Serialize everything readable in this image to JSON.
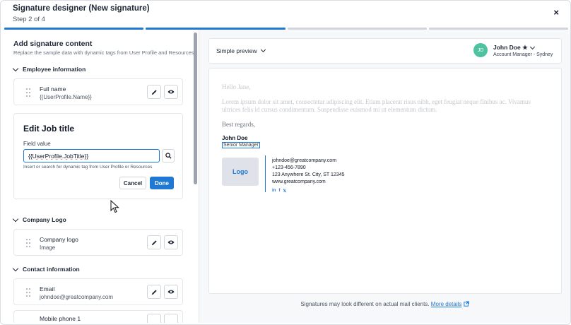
{
  "header": {
    "title": "Signature designer (New signature)",
    "step": "Step 2 of 4",
    "close_icon": "×"
  },
  "progress": {
    "total_steps": 4,
    "completed_steps": 2
  },
  "left": {
    "title": "Add signature content",
    "description": "Replace the sample data with dynamic tags from User Profile and Resources",
    "groups": {
      "employee": "Employee information",
      "company_logo": "Company Logo",
      "contact": "Contact information"
    },
    "fields": {
      "full_name": {
        "name": "Full name",
        "value": "{{UserProfile.Name}}"
      },
      "company_logo": {
        "name": "Company logo",
        "value": "Image"
      },
      "email": {
        "name": "Email",
        "value": "johndoe@greatcompany.com"
      },
      "mobile": {
        "name": "Mobile phone 1"
      }
    },
    "edit": {
      "title": "Edit Job title",
      "field_label": "Field value",
      "value": "{{UserProfile.JobTitle}}",
      "hint": "Insert or search for dynamic tag from User Profile or Resources",
      "cancel": "Cancel",
      "done": "Done"
    }
  },
  "right": {
    "preview_mode": "Simple preview",
    "user": {
      "initials": "JD",
      "name": "John Doe ★",
      "role": "Account Manager - Sydney"
    },
    "email": {
      "greeting": "Hello Jane,",
      "body": "Lorem ipsum dolor sit amet, consectetur adipiscing elit. Etiam placerat risus nibh, eget feugiat neque finibus ac. Vivamus ultrices felis id cursus condimentum. Suspendisse euismod mi ut elementum dictum.",
      "closing": "Best regards,"
    },
    "signature": {
      "name": "John Doe",
      "title": "Senior Manager",
      "logo": "Logo",
      "email": "johndoe@greatcompany.com",
      "phone": "+123-456-7890",
      "address": "123 Anywhere St. City, ST 12345",
      "website": "www.greatcompany.com",
      "socials": [
        "in",
        "f",
        "𝕏"
      ]
    },
    "footer": {
      "note": "Signatures may look different on actual mail clients.",
      "link": "More details"
    }
  },
  "colors": {
    "accent": "#1e78d4",
    "avatar": "#4fc39f"
  }
}
